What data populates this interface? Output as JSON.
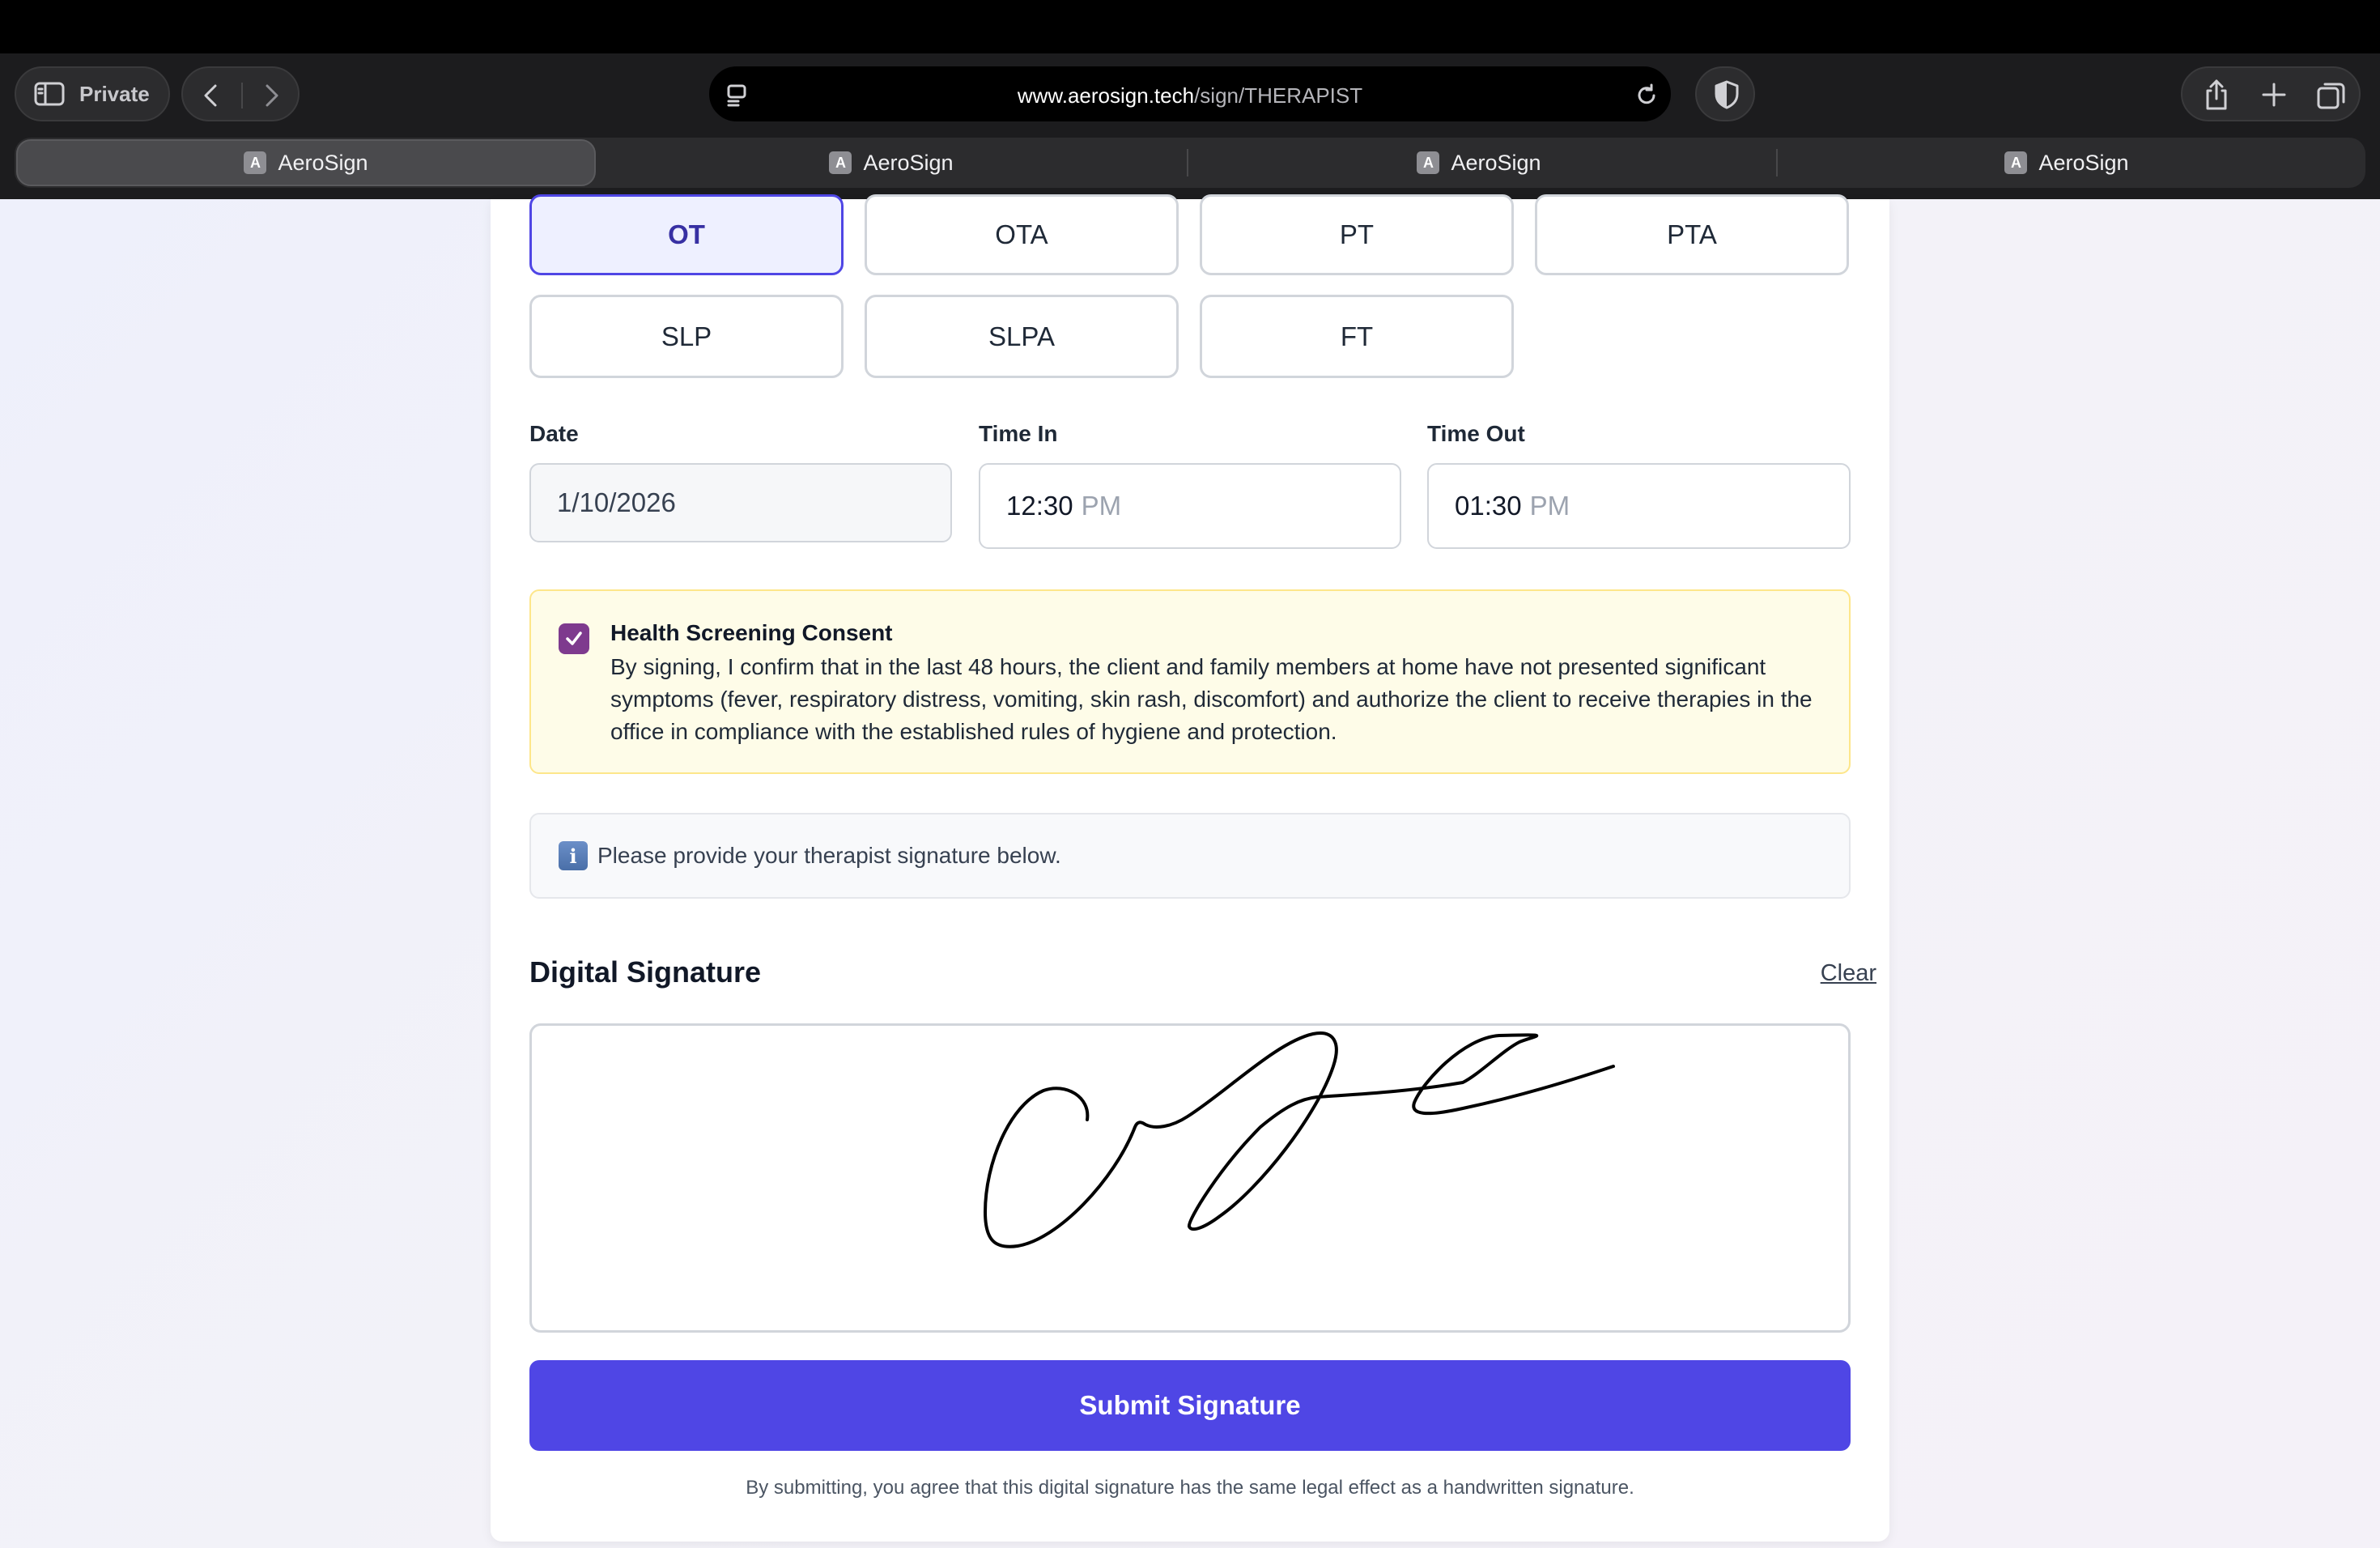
{
  "browser": {
    "private_label": "Private",
    "url_domain": "www.aerosign.tech",
    "url_path": "/sign/THERAPIST",
    "tabs": [
      {
        "title": "AeroSign",
        "favicon": "A"
      },
      {
        "title": "AeroSign",
        "favicon": "A"
      },
      {
        "title": "AeroSign",
        "favicon": "A"
      },
      {
        "title": "AeroSign",
        "favicon": "A"
      }
    ]
  },
  "roles": {
    "selected": "OT",
    "options": [
      "OT",
      "OTA",
      "PT",
      "PTA",
      "SLP",
      "SLPA",
      "FT"
    ]
  },
  "fields": {
    "date_label": "Date",
    "date_value": "1/10/2026",
    "time_in_label": "Time In",
    "time_in_value": "12:30",
    "time_in_ampm": "PM",
    "time_out_label": "Time Out",
    "time_out_value": "01:30",
    "time_out_ampm": "PM"
  },
  "consent": {
    "checked": true,
    "title": "Health Screening Consent",
    "body": "By signing, I confirm that in the last 48 hours, the client and family members at home have not presented significant symptoms (fever, respiratory distress, vomiting, skin rash, discomfort) and authorize the client to receive therapies in the office in compliance with the established rules of hygiene and protection."
  },
  "info": {
    "icon": "i",
    "text": "Please provide your therapist signature below."
  },
  "signature": {
    "title": "Digital Signature",
    "clear_label": "Clear"
  },
  "submit": {
    "label": "Submit Signature",
    "disclaimer": "By submitting, you agree that this digital signature has the same legal effect as a handwritten signature."
  },
  "colors": {
    "primary": "#4f46e5",
    "selected_bg": "#eef0ff",
    "consent_bg": "#fefce8",
    "consent_border": "#fde68a",
    "checkbox": "#7e3a8e"
  }
}
